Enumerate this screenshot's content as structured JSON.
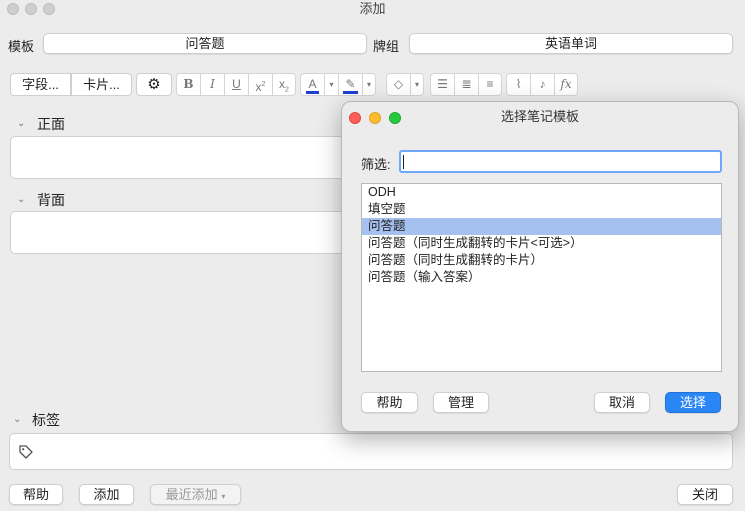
{
  "window": {
    "title": "添加"
  },
  "header": {
    "model_label": "模板",
    "model_value": "问答题",
    "deck_label": "牌组",
    "deck_value": "英语单词"
  },
  "toolbar": {
    "fields_button": "字段...",
    "cards_button": "卡片...",
    "icons": [
      "gear-icon",
      "bold-icon",
      "italic-icon",
      "underline-icon",
      "superscript-icon",
      "subscript-icon",
      "text-color-icon",
      "highlight-icon",
      "eraser-icon",
      "bullet-list-icon",
      "numbered-list-icon",
      "align-icon",
      "attach-icon",
      "microphone-icon",
      "formula-icon"
    ],
    "text_color": "#1f3fd1",
    "highlight_color": "#1f3fd1"
  },
  "editor": {
    "front_label": "正面",
    "back_label": "背面",
    "tags_label": "标签"
  },
  "bottom_bar": {
    "help_button": "帮助",
    "add_button": "添加",
    "history_button": "最近添加",
    "close_button": "关闭"
  },
  "dialog": {
    "title": "选择笔记模板",
    "filter_label": "筛选:",
    "filter_value": "",
    "items": [
      "ODH",
      "填空题",
      "问答题",
      "问答题（同时生成翻转的卡片<可选>）",
      "问答题（同时生成翻转的卡片）",
      "问答题（输入答案）"
    ],
    "selected_index": 2,
    "help_button": "帮助",
    "manage_button": "管理",
    "cancel_button": "取消",
    "choose_button": "选择",
    "traffic_colors": [
      "#fe5f57",
      "#febc2e",
      "#28c840"
    ],
    "accent_color": "#2b86f5"
  }
}
